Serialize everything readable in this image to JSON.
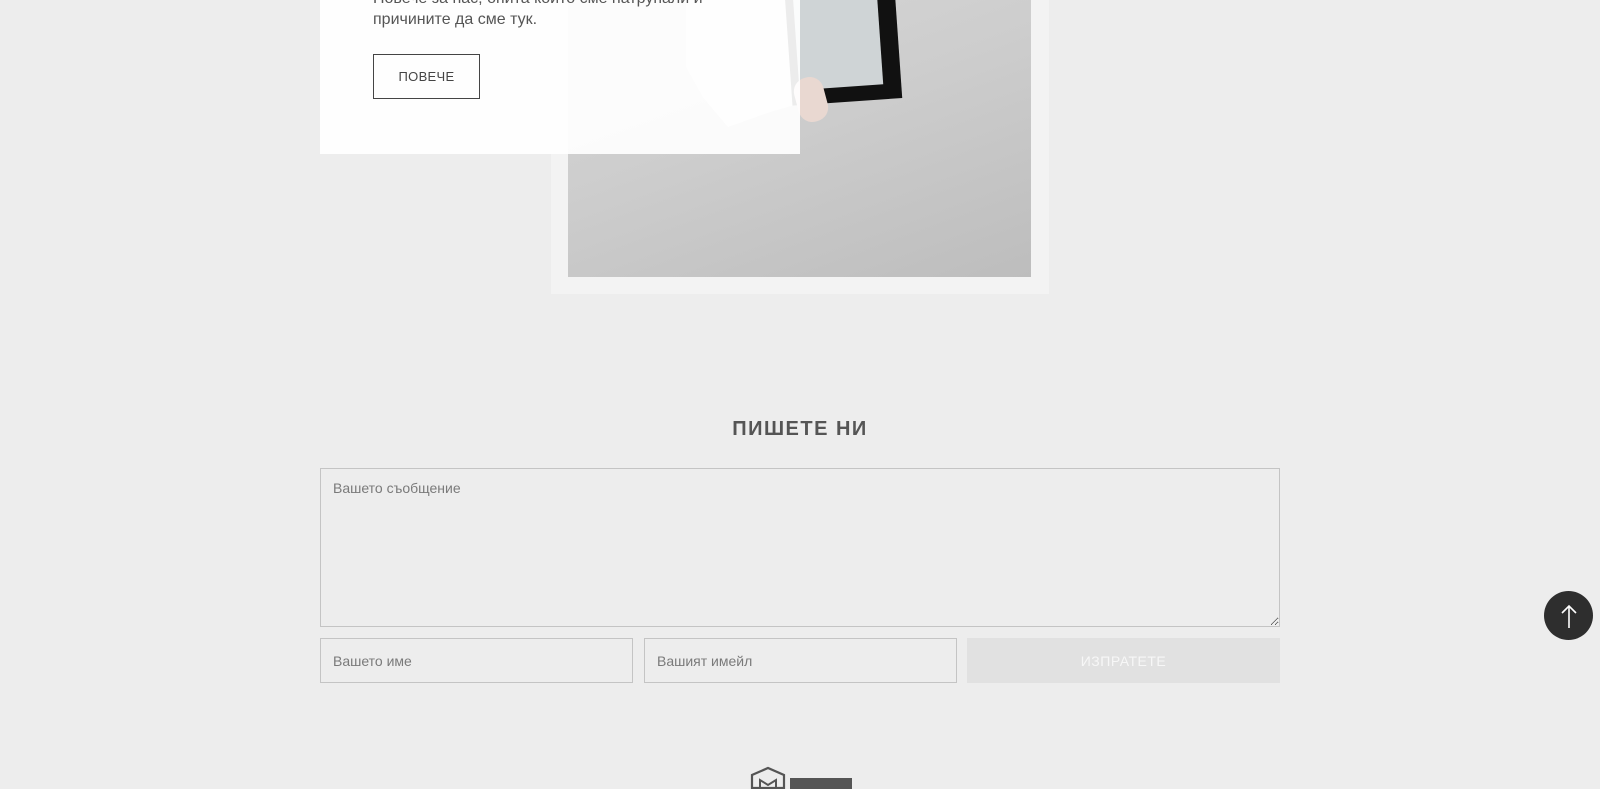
{
  "about": {
    "text": "Повече за нас, опита които сме натрупали и причините да сме тук.",
    "button_label": "ПОВЕЧЕ"
  },
  "contact": {
    "title": "ПИШЕТЕ НИ",
    "message_placeholder": "Вашето съобщение",
    "name_placeholder": "Вашето име",
    "email_placeholder": "Вашият имейл",
    "submit_label": "ИЗПРАТЕТЕ"
  },
  "colors": {
    "page_background": "#ededed",
    "back_to_top_background": "#2e2e2e",
    "submit_background": "#e1e1e1"
  },
  "icons": {
    "back_to_top": "arrow-up-icon",
    "footer_logo": "logo-icon"
  }
}
